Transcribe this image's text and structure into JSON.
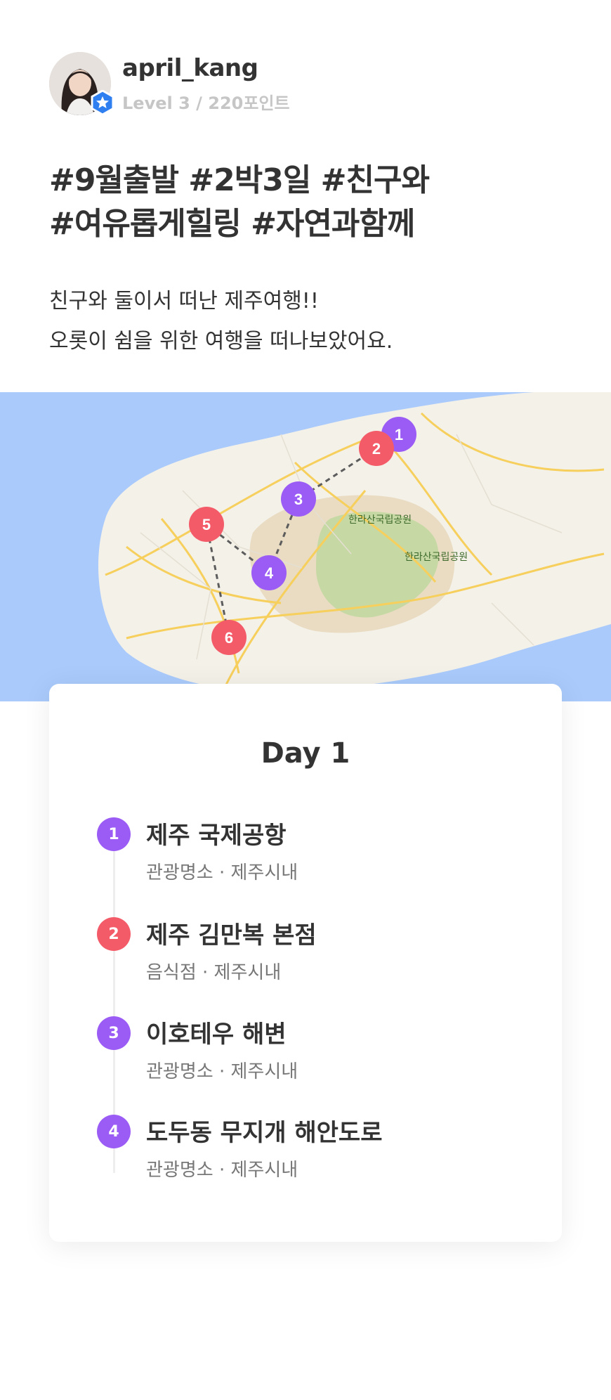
{
  "profile": {
    "username": "april_kang",
    "level": "Level 3 / 220포인트"
  },
  "post": {
    "hashtags": [
      "#9월출발 #2박3일 #친구와",
      "#여유롭게힐링 #자연과함께"
    ],
    "description": [
      "친구와 둘이서 떠난 제주여행!!",
      "오롯이 쉼을 위한 여행을 떠나보았어요."
    ]
  },
  "map": {
    "park_labels": [
      "한라산국립공원",
      "한라산국립공원"
    ],
    "markers": [
      {
        "num": "1",
        "color": "#9b5cf6"
      },
      {
        "num": "2",
        "color": "#f45b69"
      },
      {
        "num": "3",
        "color": "#9b5cf6"
      },
      {
        "num": "4",
        "color": "#9b5cf6"
      },
      {
        "num": "5",
        "color": "#f45b69"
      },
      {
        "num": "6",
        "color": "#f45b69"
      }
    ]
  },
  "day": {
    "title": "Day 1",
    "stops": [
      {
        "num": "1",
        "name": "제주 국제공항",
        "meta": "관광명소 · 제주시내",
        "color": "#9b5cf6"
      },
      {
        "num": "2",
        "name": "제주 김만복 본점",
        "meta": "음식점 · 제주시내",
        "color": "#f45b69"
      },
      {
        "num": "3",
        "name": "이호테우 해변",
        "meta": "관광명소 · 제주시내",
        "color": "#9b5cf6"
      },
      {
        "num": "4",
        "name": "도두동 무지개 해안도로",
        "meta": "관광명소 · 제주시내",
        "color": "#9b5cf6"
      }
    ]
  }
}
